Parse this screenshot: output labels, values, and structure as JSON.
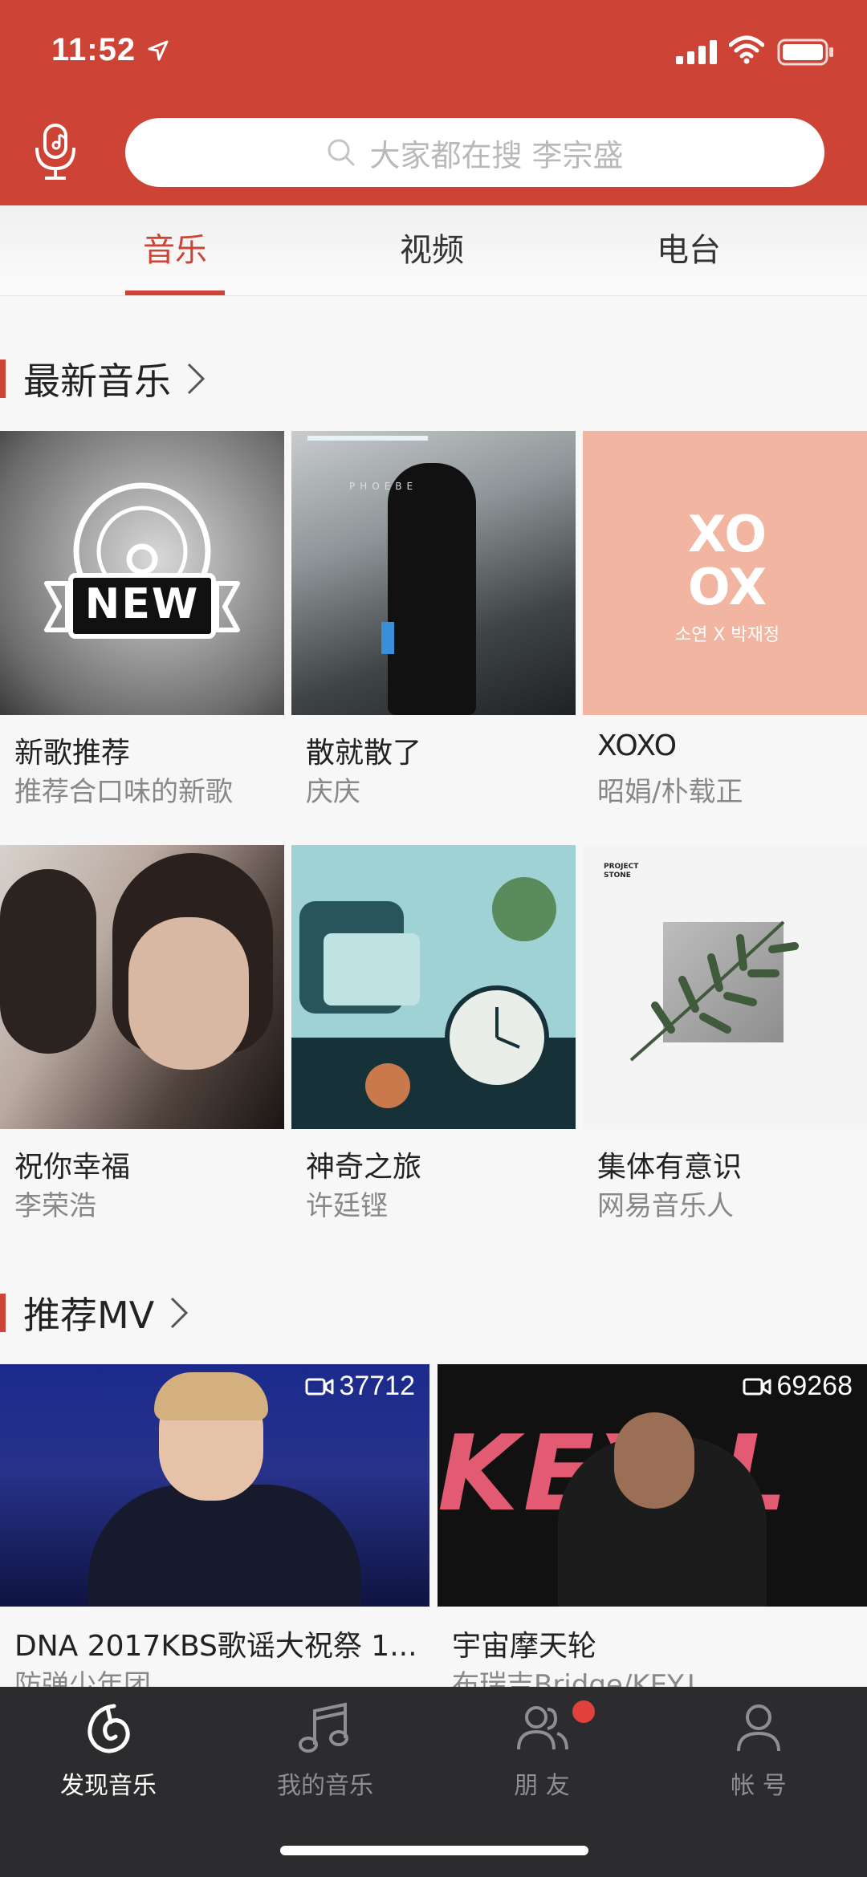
{
  "status": {
    "time": "11:52"
  },
  "search": {
    "placeholder": "大家都在搜 李宗盛"
  },
  "tabs": [
    {
      "label": "音乐",
      "active": true
    },
    {
      "label": "视频",
      "active": false
    },
    {
      "label": "电台",
      "active": false
    }
  ],
  "new_music": {
    "title": "最新音乐",
    "items": [
      {
        "title": "新歌推荐",
        "subtitle": "推荐合口味的新歌",
        "cover_text": "NEW"
      },
      {
        "title": "散就散了",
        "subtitle": "庆庆",
        "cover_text": "PHOEBE"
      },
      {
        "title": "XOXO",
        "subtitle": "昭娟/朴载正",
        "cover_text": "XO OX",
        "cover_sub": "소연 X 박재정"
      },
      {
        "title": "祝你幸福",
        "subtitle": "李荣浩"
      },
      {
        "title": "神奇之旅",
        "subtitle": "许廷铿"
      },
      {
        "title": "集体有意识",
        "subtitle": "网易音乐人",
        "cover_text": "PROJECT STONE"
      }
    ]
  },
  "recommended_mv": {
    "title": "推荐MV",
    "items": [
      {
        "title": "DNA 2017KBS歌谣大祝祭 1...",
        "subtitle": "防弹少年团",
        "views": "37712"
      },
      {
        "title": "宇宙摩天轮",
        "subtitle": "布瑞吉Bridge/KEY.L",
        "views": "69268"
      }
    ]
  },
  "bottom_nav": [
    {
      "label": "发现音乐",
      "icon": "netease-music-icon",
      "active": true
    },
    {
      "label": "我的音乐",
      "icon": "music-note-icon",
      "active": false
    },
    {
      "label": "朋 友",
      "icon": "friends-icon",
      "active": false,
      "badge": true
    },
    {
      "label": "帐 号",
      "icon": "account-icon",
      "active": false
    }
  ],
  "colors": {
    "brand": "#cd4335",
    "nav_bg": "#2c2c2e"
  }
}
